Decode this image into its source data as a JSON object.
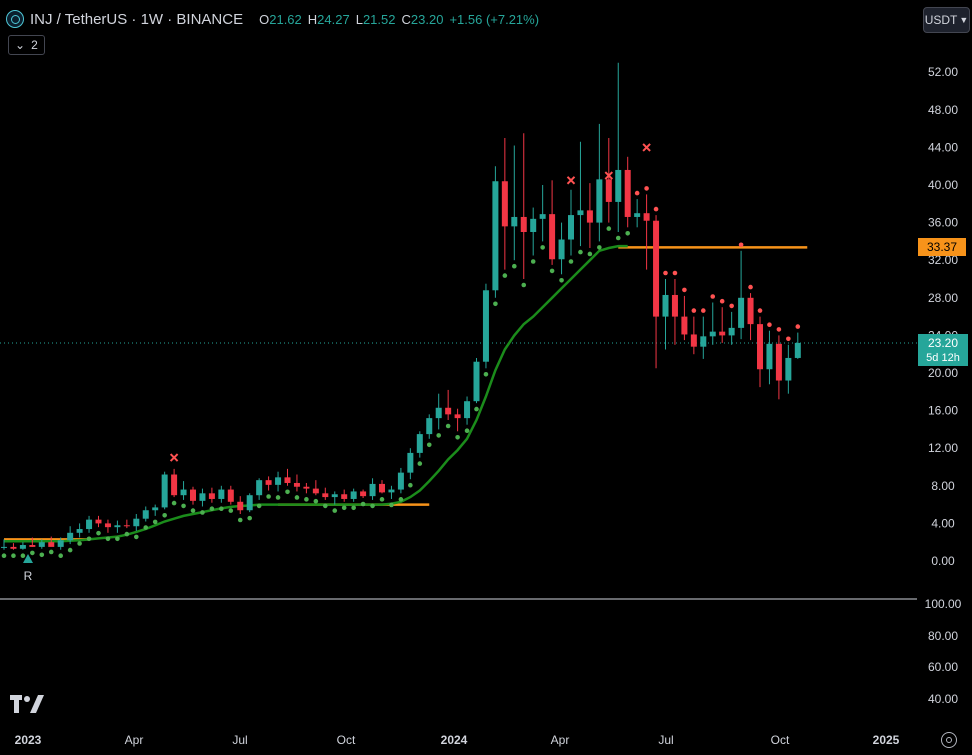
{
  "header": {
    "symbol": "INJ / TetherUS · 1W · BINANCE",
    "o_label": "O",
    "o_value": "21.62",
    "h_label": "H",
    "h_value": "24.27",
    "l_label": "L",
    "l_value": "21.52",
    "c_label": "C",
    "c_value": "23.20",
    "change": "+1.56 (+7.21%)"
  },
  "indicator_toggle": {
    "count": "2"
  },
  "currency_button": "USDT",
  "price_label": {
    "value": "23.20",
    "countdown": "5d 12h"
  },
  "level_label": "33.37",
  "marker_r": "R",
  "colors": {
    "up": "#26a69a",
    "down": "#f23645",
    "ma": "#1b8c1b",
    "level": "#f7931a",
    "dot_up": "#4caf50",
    "dot_down": "#ff5252"
  },
  "chart_data": {
    "type": "candlestick",
    "title": "INJ / TetherUS · 1W · BINANCE",
    "ylim": [
      -2,
      55
    ],
    "y_ticks": [
      "0.00",
      "4.00",
      "8.00",
      "12.00",
      "16.00",
      "20.00",
      "24.00",
      "28.00",
      "32.00",
      "36.00",
      "40.00",
      "44.00",
      "48.00",
      "52.00"
    ],
    "x_ticks": [
      "2023",
      "Apr",
      "Jul",
      "Oct",
      "2024",
      "Apr",
      "Jul",
      "Oct",
      "2025"
    ],
    "candles": [
      [
        1.5,
        2.3,
        1.2,
        1.5
      ],
      [
        1.5,
        1.9,
        1.2,
        1.3
      ],
      [
        1.3,
        2.0,
        1.2,
        1.7
      ],
      [
        1.7,
        2.5,
        1.5,
        1.5
      ],
      [
        1.5,
        2.3,
        1.3,
        2.0
      ],
      [
        2.0,
        2.6,
        1.6,
        1.5
      ],
      [
        1.5,
        2.5,
        1.2,
        2.2
      ],
      [
        2.2,
        3.7,
        1.8,
        3.0
      ],
      [
        3.0,
        4.0,
        2.5,
        3.4
      ],
      [
        3.4,
        4.8,
        3.0,
        4.4
      ],
      [
        4.4,
        4.8,
        3.6,
        4.0
      ],
      [
        4.0,
        4.4,
        3.0,
        3.6
      ],
      [
        3.6,
        4.3,
        3.0,
        3.8
      ],
      [
        3.8,
        4.4,
        3.5,
        3.7
      ],
      [
        3.7,
        5.0,
        3.2,
        4.5
      ],
      [
        4.5,
        5.8,
        4.2,
        5.4
      ],
      [
        5.4,
        6.0,
        4.8,
        5.7
      ],
      [
        5.7,
        9.5,
        5.5,
        9.2
      ],
      [
        9.2,
        9.8,
        6.8,
        7.0
      ],
      [
        7.0,
        8.5,
        6.5,
        7.6
      ],
      [
        7.6,
        7.9,
        6.0,
        6.4
      ],
      [
        6.4,
        7.7,
        5.8,
        7.2
      ],
      [
        7.2,
        7.8,
        6.2,
        6.6
      ],
      [
        6.6,
        8.0,
        6.2,
        7.6
      ],
      [
        7.6,
        8.0,
        6.0,
        6.3
      ],
      [
        6.3,
        6.9,
        5.0,
        5.4
      ],
      [
        5.4,
        7.2,
        5.2,
        7.0
      ],
      [
        7.0,
        8.8,
        6.5,
        8.6
      ],
      [
        8.6,
        9.0,
        7.5,
        8.1
      ],
      [
        8.1,
        9.5,
        7.4,
        8.9
      ],
      [
        8.9,
        9.8,
        8.0,
        8.3
      ],
      [
        8.3,
        9.2,
        7.4,
        7.9
      ],
      [
        7.9,
        8.3,
        7.2,
        7.7
      ],
      [
        7.7,
        8.6,
        7.0,
        7.2
      ],
      [
        7.2,
        7.8,
        6.5,
        6.8
      ],
      [
        6.8,
        7.4,
        6.0,
        7.1
      ],
      [
        7.1,
        7.6,
        6.3,
        6.6
      ],
      [
        6.6,
        7.7,
        6.3,
        7.4
      ],
      [
        7.4,
        7.6,
        6.7,
        6.9
      ],
      [
        6.9,
        8.8,
        6.5,
        8.2
      ],
      [
        8.2,
        8.6,
        7.2,
        7.3
      ],
      [
        7.3,
        8.0,
        6.6,
        7.6
      ],
      [
        7.6,
        9.9,
        7.2,
        9.4
      ],
      [
        9.4,
        12.0,
        8.7,
        11.5
      ],
      [
        11.5,
        13.8,
        11.0,
        13.5
      ],
      [
        13.5,
        15.6,
        13.0,
        15.2
      ],
      [
        15.2,
        17.8,
        14.0,
        16.3
      ],
      [
        16.3,
        18.2,
        15.0,
        15.6
      ],
      [
        15.6,
        16.2,
        13.8,
        15.2
      ],
      [
        15.2,
        17.5,
        14.5,
        17.0
      ],
      [
        17.0,
        21.6,
        16.8,
        21.2
      ],
      [
        21.2,
        29.5,
        20.5,
        28.8
      ],
      [
        28.8,
        42.0,
        28.0,
        40.4
      ],
      [
        40.4,
        45.0,
        31.0,
        35.6
      ],
      [
        35.6,
        44.2,
        32.0,
        36.6
      ],
      [
        36.6,
        45.5,
        30.0,
        35.0
      ],
      [
        35.0,
        37.6,
        32.5,
        36.4
      ],
      [
        36.4,
        40.0,
        34.0,
        36.9
      ],
      [
        36.9,
        40.5,
        31.5,
        32.1
      ],
      [
        32.1,
        36.0,
        30.5,
        34.2
      ],
      [
        34.2,
        39.5,
        32.5,
        36.8
      ],
      [
        36.8,
        44.6,
        33.5,
        37.3
      ],
      [
        37.3,
        40.2,
        33.3,
        36.0
      ],
      [
        36.0,
        46.5,
        34.0,
        40.6
      ],
      [
        40.6,
        45.0,
        36.0,
        38.2
      ],
      [
        38.2,
        53.0,
        35.0,
        41.6
      ],
      [
        41.6,
        43.0,
        35.5,
        36.6
      ],
      [
        36.6,
        38.5,
        35.5,
        37.0
      ],
      [
        37.0,
        39.0,
        31.0,
        36.2
      ],
      [
        36.2,
        36.8,
        20.5,
        26.0
      ],
      [
        26.0,
        30.0,
        22.5,
        28.3
      ],
      [
        28.3,
        30.0,
        23.0,
        26.0
      ],
      [
        26.0,
        28.2,
        23.5,
        24.1
      ],
      [
        24.1,
        26.0,
        22.0,
        22.8
      ],
      [
        22.8,
        26.0,
        21.5,
        23.9
      ],
      [
        23.9,
        27.5,
        23.0,
        24.4
      ],
      [
        24.4,
        27.0,
        23.2,
        24.0
      ],
      [
        24.0,
        26.5,
        23.0,
        24.8
      ],
      [
        24.8,
        33.0,
        23.6,
        28.0
      ],
      [
        28.0,
        28.5,
        23.5,
        25.2
      ],
      [
        25.2,
        26.0,
        18.5,
        20.4
      ],
      [
        20.4,
        24.5,
        18.8,
        23.1
      ],
      [
        23.1,
        24.0,
        17.2,
        19.2
      ],
      [
        19.2,
        23.0,
        17.8,
        21.6
      ],
      [
        21.6,
        24.3,
        21.5,
        23.2
      ]
    ],
    "ma_line": [
      2.1,
      2.1,
      2.1,
      2.1,
      2.1,
      2.1,
      2.1,
      2.15,
      2.2,
      2.3,
      2.4,
      2.5,
      2.6,
      2.8,
      3.1,
      3.4,
      3.8,
      4.2,
      4.5,
      4.8,
      5.0,
      5.2,
      5.4,
      5.6,
      5.75,
      5.85,
      5.9,
      6.0,
      6.0,
      6.0,
      6.0,
      6.0,
      6.0,
      6.0,
      6.0,
      6.0,
      6.0,
      6.0,
      6.0,
      6.0,
      6.0,
      6.1,
      6.3,
      6.8,
      7.5,
      8.5,
      9.6,
      10.8,
      11.8,
      13.0,
      15.0,
      17.5,
      20.3,
      22.5,
      24.0,
      25.2,
      26.0,
      27.0,
      28.0,
      29.0,
      30.0,
      31.0,
      32.0,
      33.0,
      33.3,
      33.5,
      33.5
    ],
    "levels": [
      {
        "value": 33.37,
        "from": 65,
        "to": 85
      },
      {
        "value": 6.0,
        "from": 29,
        "to": 45
      },
      {
        "value": 2.3,
        "from": 0,
        "to": 9
      }
    ],
    "sell_marks": [
      {
        "i": 18,
        "y": 11.0
      },
      {
        "i": 60,
        "y": 40.5
      },
      {
        "i": 64,
        "y": 41.0
      },
      {
        "i": 68,
        "y": 44.0
      }
    ],
    "lower_pane_ticks": [
      "100.00",
      "80.00",
      "60.00",
      "40.00"
    ]
  }
}
